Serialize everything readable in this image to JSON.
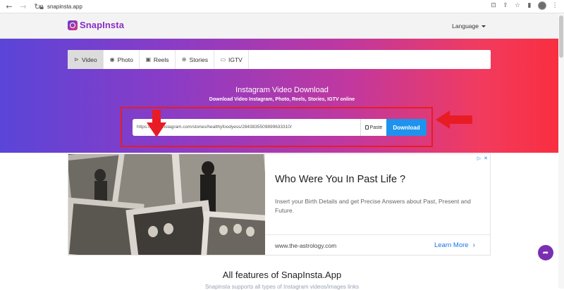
{
  "browser": {
    "url": "snapinsta.app"
  },
  "header": {
    "brand": "SnapInsta",
    "language_label": "Language"
  },
  "tabs": [
    {
      "label": "Video",
      "icon": "video-icon",
      "active": true
    },
    {
      "label": "Photo",
      "icon": "camera-icon",
      "active": false
    },
    {
      "label": "Reels",
      "icon": "reels-icon",
      "active": false
    },
    {
      "label": "Stories",
      "icon": "stories-icon",
      "active": false
    },
    {
      "label": "IGTV",
      "icon": "tv-icon",
      "active": false
    }
  ],
  "hero": {
    "title": "Instagram Video Download",
    "subtitle": "Download Video Instagram, Photo, Reels, Stories, IGTV online",
    "input_value": "https://www.instagram.com/stories/healthyfoodyess/2843835509899633310/",
    "paste_label": "Paste",
    "download_label": "Download"
  },
  "ad": {
    "headline": "Who Were You In Past Life ?",
    "body": "Insert your Birth Details and get Precise Answers about Past, Present and Future.",
    "url": "www.the-astrology.com",
    "cta": "Learn More"
  },
  "features": {
    "title": "All features of SnapInsta.App",
    "subtitle": "Snapinsta supports all types of Instagram videos/images links"
  },
  "colors": {
    "brand": "#8a2ec4",
    "download_button": "#1e93ee",
    "highlight": "#e81c24",
    "share_fab": "#7a2fb2"
  }
}
